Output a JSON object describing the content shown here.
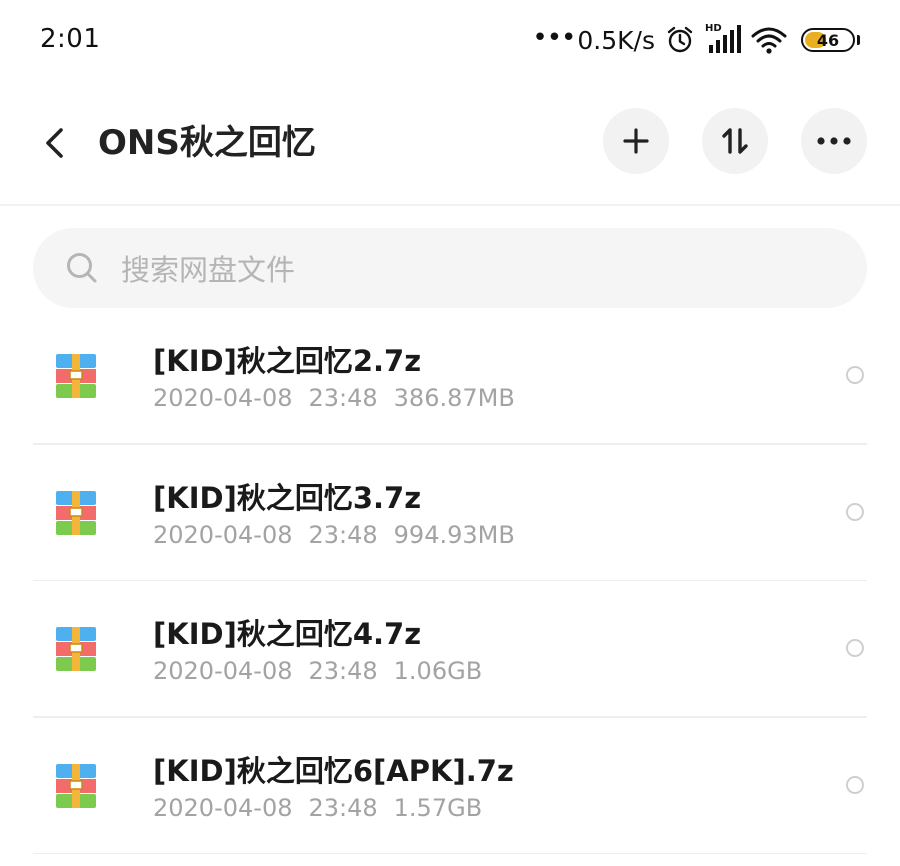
{
  "status_bar": {
    "time": "2:01",
    "network_dots": "•••",
    "network_speed": "0.5K/s",
    "alarm_icon": "alarm-clock-icon",
    "signal_icon": "hd-signal-icon",
    "signal_label": "HD",
    "wifi_icon": "wifi-icon",
    "battery_level": "46",
    "battery_fill_percent": 46,
    "battery_color": "#e8b020"
  },
  "header": {
    "back_icon": "chevron-left-icon",
    "title": "ONS秋之回忆",
    "actions": [
      {
        "name": "add",
        "icon": "plus-icon"
      },
      {
        "name": "sort",
        "icon": "sort-arrows-icon"
      },
      {
        "name": "more",
        "icon": "more-horizontal-icon"
      }
    ]
  },
  "search": {
    "icon": "search-icon",
    "placeholder": "搜索网盘文件"
  },
  "files": [
    {
      "name": "[KID]秋之回忆2.7z",
      "date": "2020-04-08",
      "time": "23:48",
      "size": "386.87MB",
      "icon": "archive-icon"
    },
    {
      "name": "[KID]秋之回忆3.7z",
      "date": "2020-04-08",
      "time": "23:48",
      "size": "994.93MB",
      "icon": "archive-icon"
    },
    {
      "name": "[KID]秋之回忆4.7z",
      "date": "2020-04-08",
      "time": "23:48",
      "size": "1.06GB",
      "icon": "archive-icon"
    },
    {
      "name": "[KID]秋之回忆6[APK].7z",
      "date": "2020-04-08",
      "time": "23:48",
      "size": "1.57GB",
      "icon": "archive-icon"
    }
  ],
  "colors": {
    "archive_top": "#4fb0f0",
    "archive_middle": "#f36b6b",
    "archive_bottom": "#7ccb4f",
    "archive_strap": "#f4b63a"
  }
}
